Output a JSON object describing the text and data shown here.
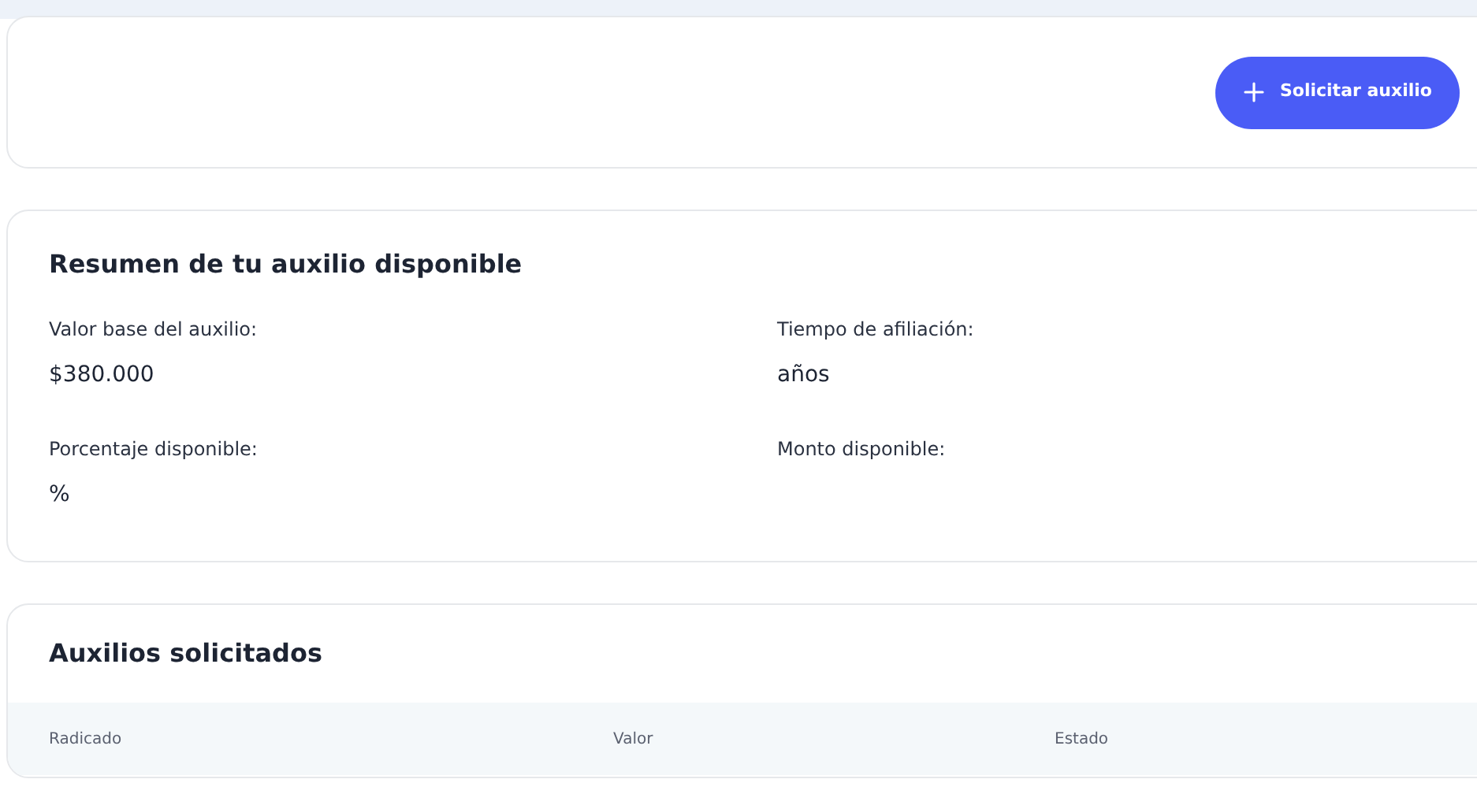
{
  "action_button": {
    "label": "Solicitar auxilio"
  },
  "summary": {
    "title": "Resumen de tu auxilio disponible",
    "fields": [
      {
        "label": "Valor base del auxilio:",
        "value": "$380.000"
      },
      {
        "label": "Tiempo de afiliación:",
        "value": "años"
      },
      {
        "label": "Porcentaje disponible:",
        "value": "%"
      },
      {
        "label": "Monto disponible:"
      }
    ]
  },
  "requests": {
    "title": "Auxilios solicitados",
    "columns": [
      "Radicado",
      "Valor",
      "Estado"
    ]
  }
}
